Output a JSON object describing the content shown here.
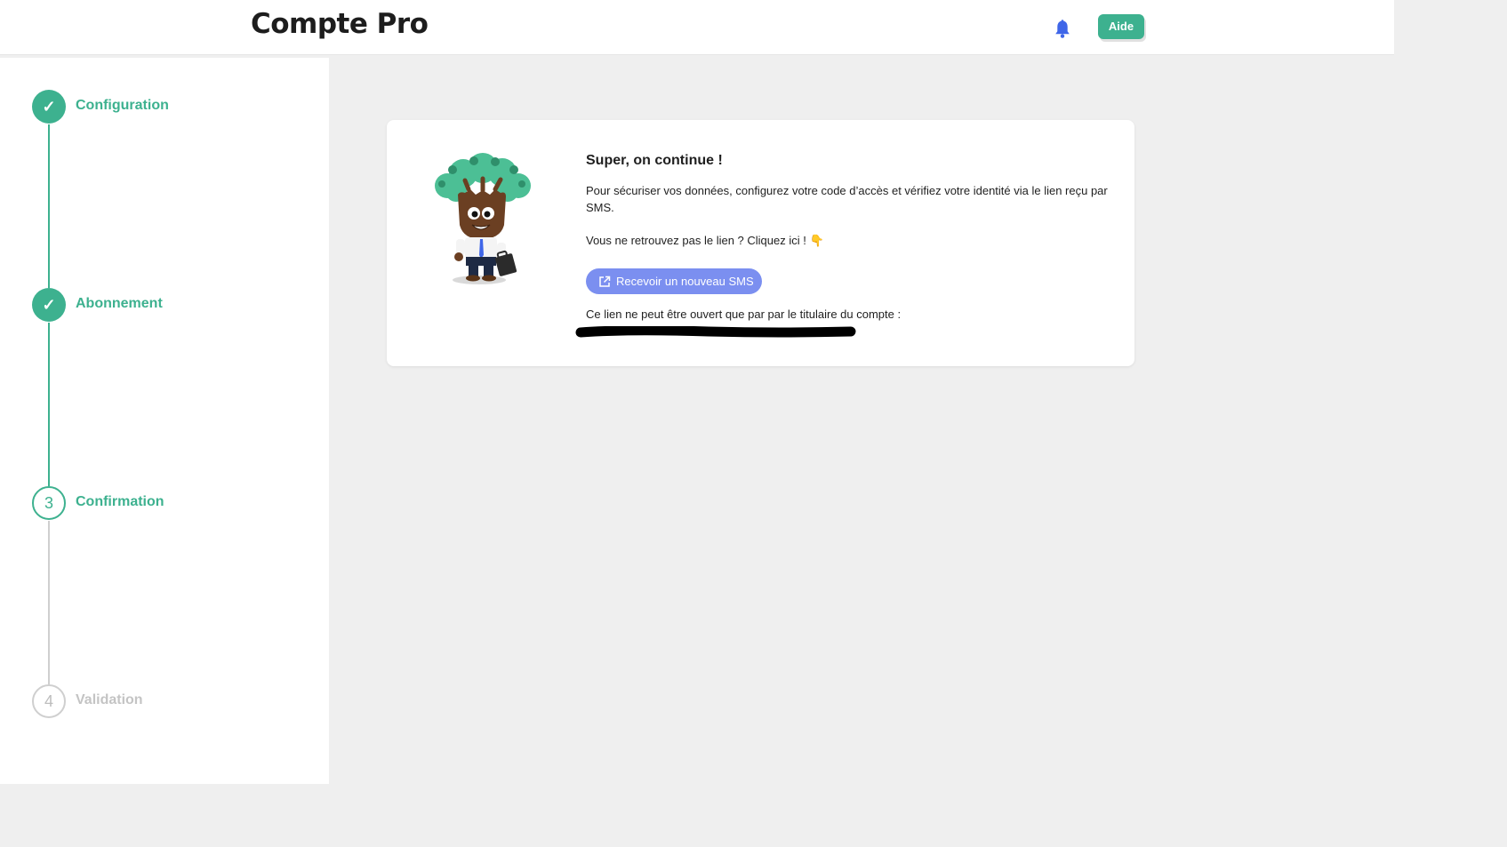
{
  "header": {
    "title": "Compte Pro",
    "bell_icon": "bell-icon",
    "help_label": "Aide"
  },
  "colors": {
    "accent": "#3db18f",
    "button_secondary": "#7b8ff0",
    "bell": "#3f66e8",
    "inactive": "#c4c4c4"
  },
  "steps": [
    {
      "label": "Configuration",
      "marker": "✓",
      "state": "done"
    },
    {
      "label": "Abonnement",
      "marker": "✓",
      "state": "done"
    },
    {
      "label": "Confirmation",
      "marker": "3",
      "state": "current"
    },
    {
      "label": "Validation",
      "marker": "4",
      "state": "todo"
    }
  ],
  "card": {
    "title": "Super, on continue !",
    "description": "Pour sécuriser vos données, configurez votre code d’accès et vérifiez votre identité via le lien reçu par SMS.",
    "hint": "Vous ne retrouvez pas le lien ? Cliquez ici ! 👇",
    "sms_button": "Recevoir un nouveau SMS",
    "sms_button_icon": "external-link-icon",
    "owner_text": "Ce lien ne peut être ouvert que par par le titulaire du compte :",
    "mascot": "tree-mascot-illustration"
  }
}
